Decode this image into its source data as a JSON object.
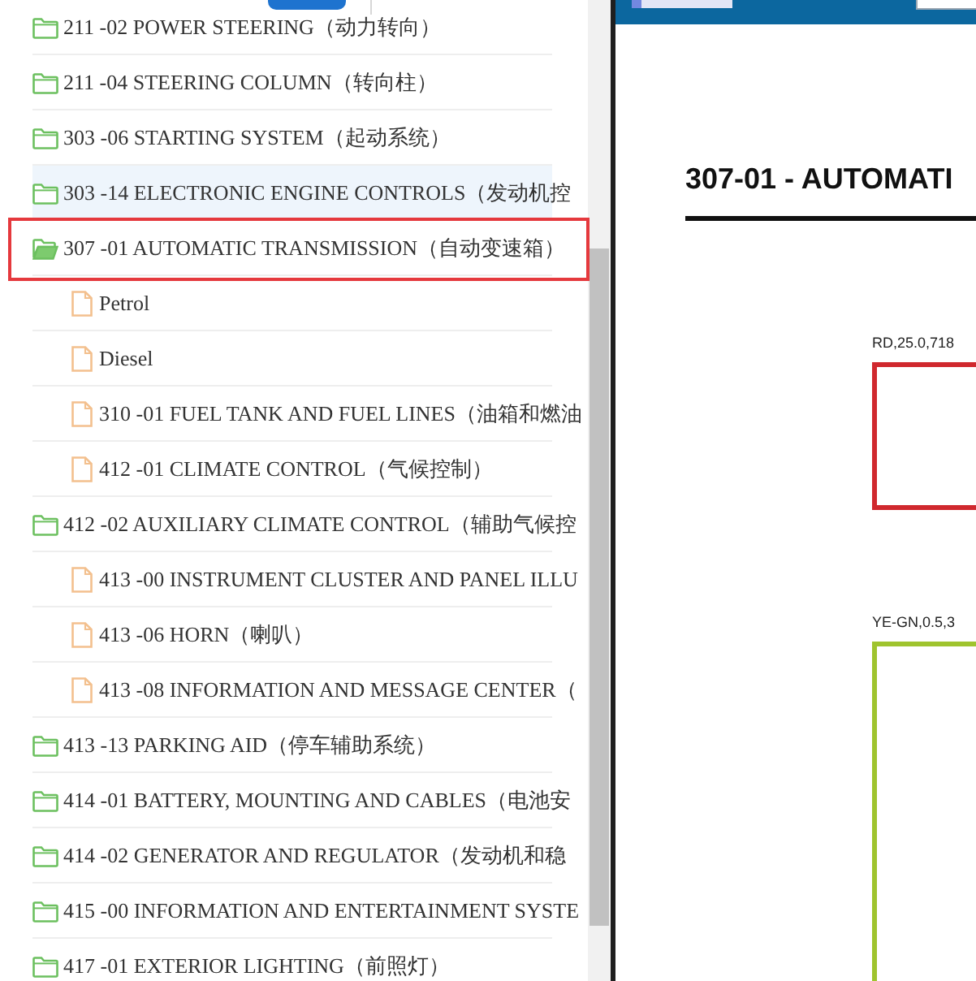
{
  "tree": {
    "items": [
      {
        "kind": "folder",
        "label": "211 -02 POWER STEERING（动力转向）",
        "hovered": false,
        "marked": false
      },
      {
        "kind": "folder",
        "label": "211 -04 STEERING COLUMN（转向柱）",
        "hovered": false,
        "marked": false
      },
      {
        "kind": "folder",
        "label": "303 -06 STARTING SYSTEM（起动系统）",
        "hovered": false,
        "marked": false
      },
      {
        "kind": "folder",
        "label": "303 -14 ELECTRONIC ENGINE CONTROLS（发动机控",
        "hovered": true,
        "marked": false
      },
      {
        "kind": "folder-open",
        "label": "307 -01 AUTOMATIC TRANSMISSION（自动变速箱）",
        "hovered": false,
        "marked": true,
        "children": [
          {
            "kind": "file",
            "label": "Petrol",
            "hovered": false,
            "marked": false
          },
          {
            "kind": "file",
            "label": "Diesel",
            "hovered": false,
            "marked": false
          }
        ]
      },
      {
        "kind": "file",
        "label": "310 -01 FUEL TANK AND FUEL LINES（油箱和燃油",
        "hovered": false,
        "marked": false
      },
      {
        "kind": "file",
        "label": "412 -01 CLIMATE CONTROL（气候控制）",
        "hovered": false,
        "marked": false
      },
      {
        "kind": "folder",
        "label": "412 -02 AUXILIARY CLIMATE CONTROL（辅助气候控",
        "hovered": false,
        "marked": false
      },
      {
        "kind": "file",
        "label": "413 -00 INSTRUMENT CLUSTER AND PANEL ILLU",
        "hovered": false,
        "marked": false
      },
      {
        "kind": "file",
        "label": "413 -06 HORN（喇叭）",
        "hovered": false,
        "marked": false
      },
      {
        "kind": "file",
        "label": "413 -08 INFORMATION AND MESSAGE CENTER（",
        "hovered": false,
        "marked": false
      },
      {
        "kind": "folder",
        "label": "413 -13 PARKING AID（停车辅助系统）",
        "hovered": false,
        "marked": false
      },
      {
        "kind": "folder",
        "label": "414 -01 BATTERY, MOUNTING AND CABLES（电池安",
        "hovered": false,
        "marked": false
      },
      {
        "kind": "folder",
        "label": "414 -02 GENERATOR AND REGULATOR（发动机和稳",
        "hovered": false,
        "marked": false
      },
      {
        "kind": "folder",
        "label": "415 -00 INFORMATION AND ENTERTAINMENT SYSTE",
        "hovered": false,
        "marked": false
      },
      {
        "kind": "folder",
        "label": "417 -01 EXTERIOR LIGHTING（前照灯）",
        "hovered": false,
        "marked": false
      }
    ]
  },
  "document": {
    "title": "307-01 - AUTOMATI",
    "wires": [
      {
        "label": "RD,25.0,718",
        "color": "#d0282e"
      },
      {
        "label": "YE-GN,0.5,3",
        "color": "#9fc42e"
      }
    ]
  }
}
